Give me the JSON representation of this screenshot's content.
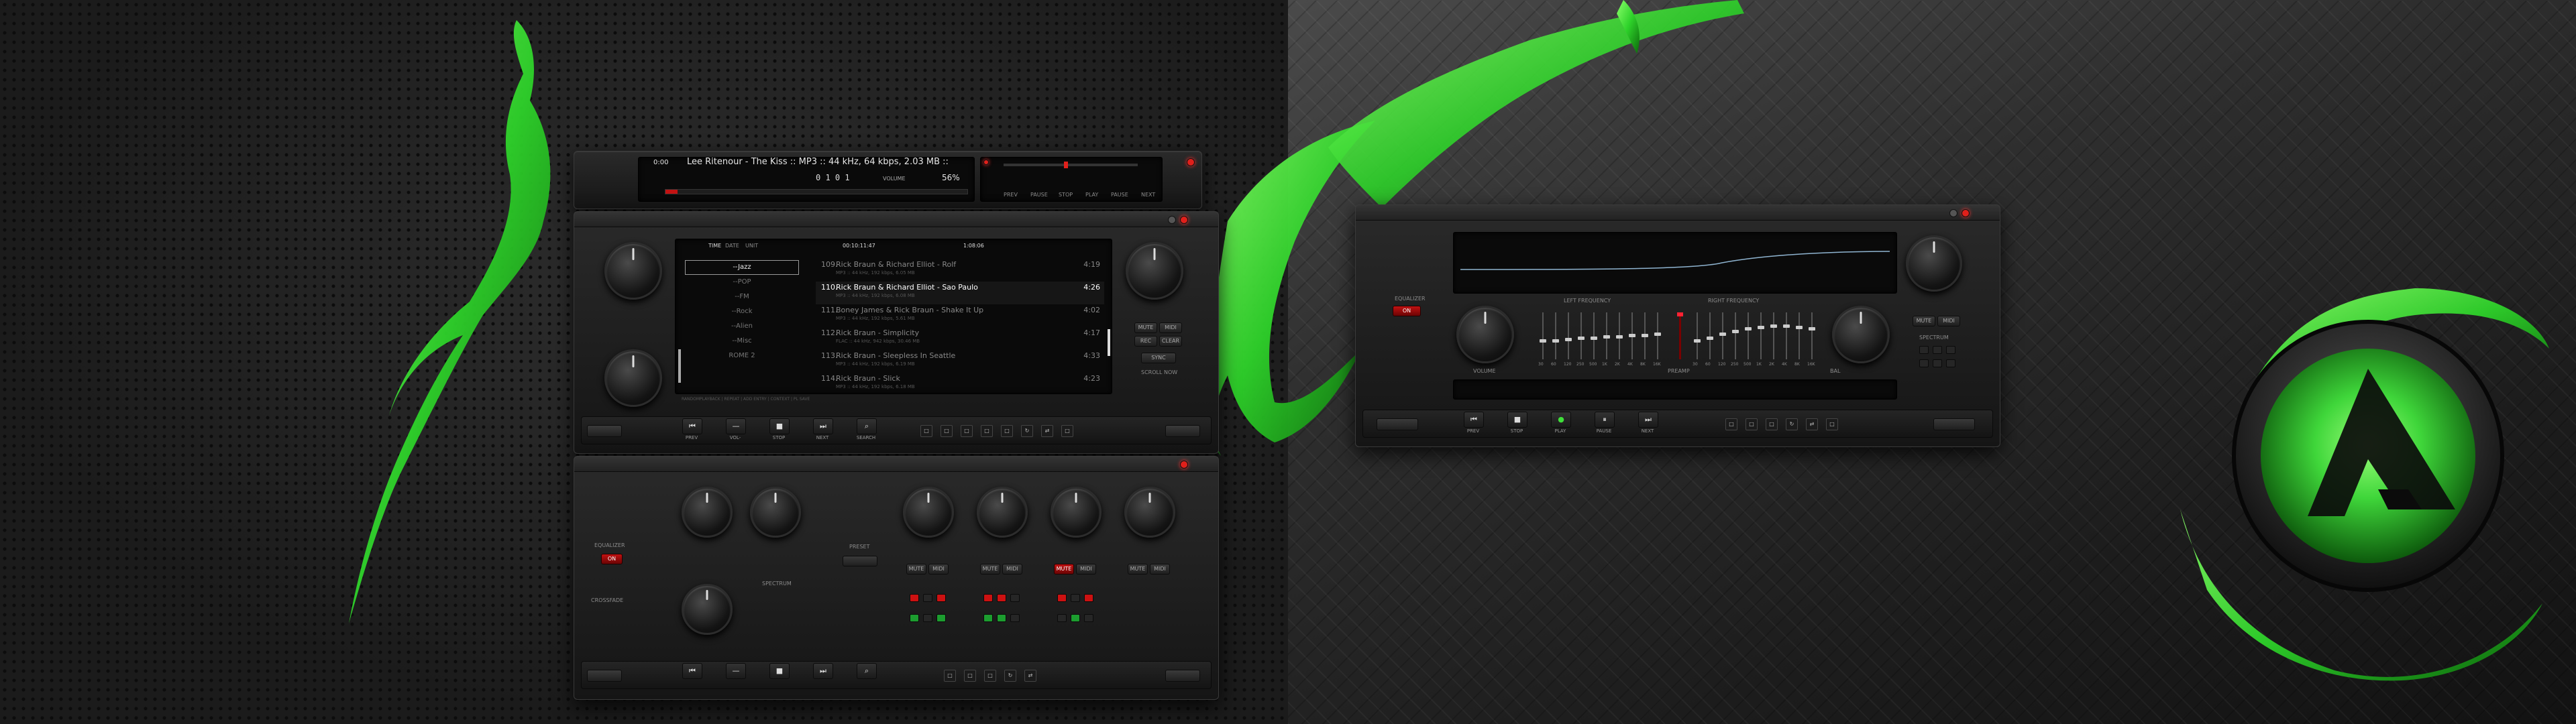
{
  "colors": {
    "accent_green": "#3fe03a",
    "accent_red": "#e0201b",
    "lcd_text": "#e6e6e6"
  },
  "player": {
    "time_display": "0:00",
    "track_line": "Lee Ritenour - The Kiss :: MP3 :: 44 kHz, 64 kbps, 2.03 MB ::",
    "counter": "0 1 0 1",
    "volume_label": "VOLUME",
    "volume_value": "56%",
    "transport": [
      "PREV",
      "PAUSE",
      "STOP",
      "PLAY",
      "PAUSE",
      "NEXT"
    ]
  },
  "playlist": {
    "header_tabs": [
      "TIME",
      "DATE",
      "UNIT"
    ],
    "header_time": "00:10:11:47",
    "header_count": "1:08:06",
    "genres": [
      "--Jazz",
      "--POP",
      "--FM",
      "--Rock",
      "--Alien",
      "--Misc",
      "ROME 2"
    ],
    "tracks": [
      {
        "num": "109.",
        "title": "Rick Braun & Richard Elliot - Rolf",
        "meta": "MP3 :: 44 kHz, 192 kbps, 6.05 MB",
        "time": "4:19"
      },
      {
        "num": "110.",
        "title": "Rick Braun & Richard Elliot - Sao Paulo",
        "meta": "MP3 :: 44 kHz, 192 kbps, 6.08 MB",
        "time": "4:26"
      },
      {
        "num": "111.",
        "title": "Boney James & Rick Braun - Shake It Up",
        "meta": "MP3 :: 44 kHz, 192 kbps, 5.61 MB",
        "time": "4:02"
      },
      {
        "num": "112.",
        "title": "Rick Braun - Simplicity",
        "meta": "FLAC :: 44 kHz, 942 kbps, 30.46 MB",
        "time": "4:17"
      },
      {
        "num": "113.",
        "title": "Rick Braun - Sleepless In Seattle",
        "meta": "MP3 :: 44 kHz, 192 kbps, 6.19 MB",
        "time": "4:33"
      },
      {
        "num": "114.",
        "title": "Rick Braun - Slick",
        "meta": "MP3 :: 44 kHz, 192 kbps, 6.18 MB",
        "time": "4:23"
      }
    ],
    "footer": "RANDOMPLAYBACK | REPEAT | ADD ENTRY | CONTEXT | PL SAVE",
    "bottom_labels": [
      "PREV",
      "VOL-",
      "STOP",
      "NEXT",
      "SEARCH"
    ],
    "right_buttons": [
      "MUTE",
      "MIDI",
      "REC",
      "CLEAR",
      "SYNC",
      "SCROLL NOW"
    ]
  },
  "eq_left": {
    "labels": {
      "equalizer": "EQUALIZER",
      "preset": "PRESET",
      "on": "ON",
      "crossfade": "CROSSFADE",
      "spectrum": "SPECTRUM"
    },
    "channel_labels": [
      "MUTE",
      "MIDI"
    ]
  },
  "right_player": {
    "titlebar": "",
    "eq_label": "EQUALIZER",
    "on": "ON",
    "volume": "VOLUME",
    "balance": "BAL",
    "bands_left_title": "LEFT FREQUENCY",
    "bands_right_title": "RIGHT FREQUENCY",
    "band_labels": [
      "30",
      "60",
      "120",
      "250",
      "500",
      "1K",
      "2K",
      "4K",
      "8K",
      "16K"
    ],
    "preamp": "PREAMP",
    "spectrum": "SPECTRUM",
    "transport": [
      "PREV",
      "STOP",
      "PLAY",
      "PAUSE",
      "NEXT"
    ],
    "buttons": [
      "MUTE",
      "MIDI",
      "REC",
      "CLEAR"
    ]
  },
  "logo": {
    "name": "AIMP logo"
  }
}
